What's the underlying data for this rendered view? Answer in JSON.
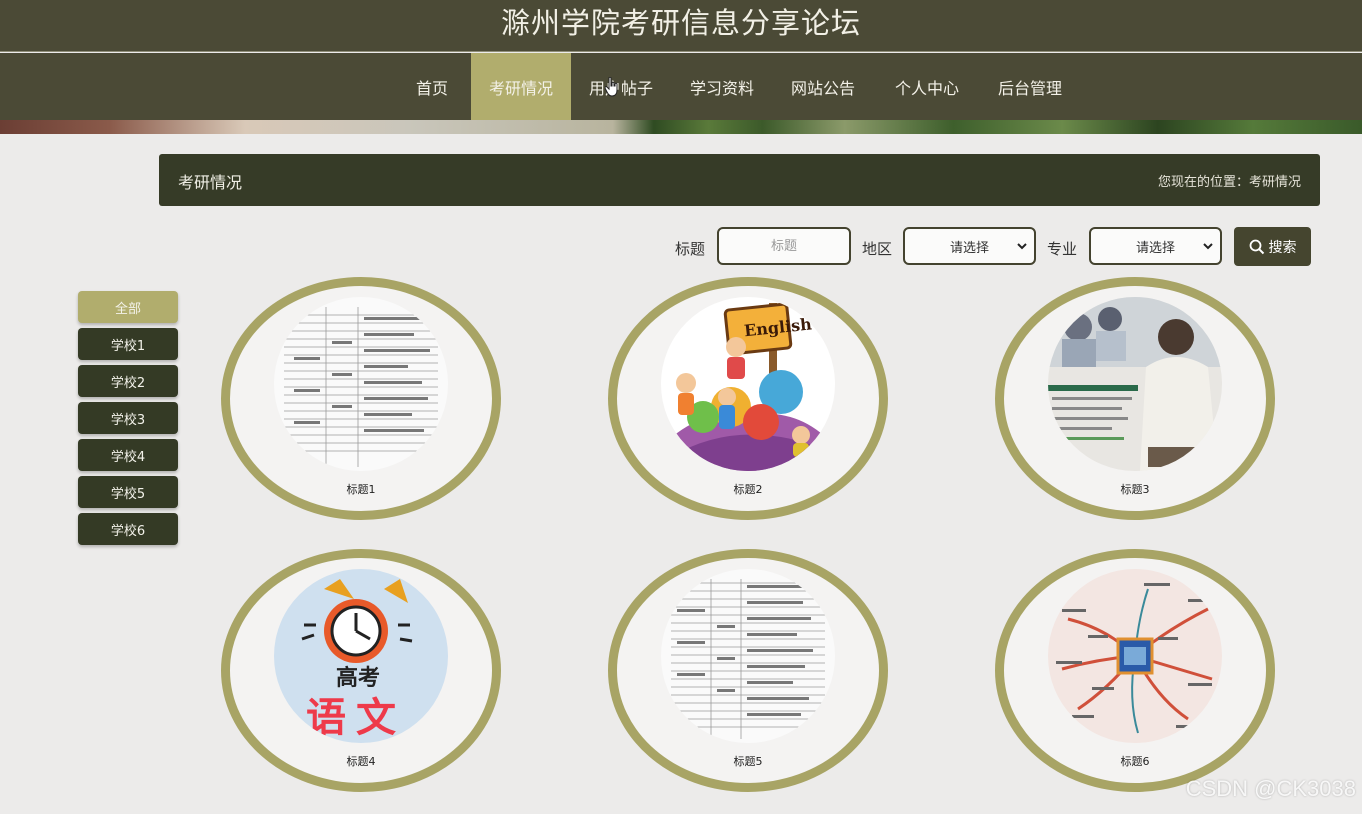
{
  "header": {
    "title": "滁州学院考研信息分享论坛"
  },
  "nav": {
    "items": [
      {
        "label": "首页"
      },
      {
        "label": "考研情况"
      },
      {
        "label": "用户帖子"
      },
      {
        "label": "学习资料"
      },
      {
        "label": "网站公告"
      },
      {
        "label": "个人中心"
      },
      {
        "label": "后台管理"
      }
    ],
    "active_index": 1
  },
  "section": {
    "title": "考研情况",
    "breadcrumb": "您现在的位置：考研情况"
  },
  "search": {
    "title_label": "标题",
    "title_placeholder": "标题",
    "region_label": "地区",
    "region_value": "请选择",
    "major_label": "专业",
    "major_value": "请选择",
    "button_label": "搜索"
  },
  "sidebar": {
    "items": [
      {
        "label": "全部"
      },
      {
        "label": "学校1"
      },
      {
        "label": "学校2"
      },
      {
        "label": "学校3"
      },
      {
        "label": "学校4"
      },
      {
        "label": "学校5"
      },
      {
        "label": "学校6"
      }
    ],
    "active_index": 0
  },
  "cards": [
    {
      "title": "标题1",
      "image": "document-table"
    },
    {
      "title": "标题2",
      "image": "english-kids-cartoon"
    },
    {
      "title": "标题3",
      "image": "chinese-textbook-poster"
    },
    {
      "title": "标题4",
      "image": "alarm-clock-gaokao-chinese"
    },
    {
      "title": "标题5",
      "image": "document-table"
    },
    {
      "title": "标题6",
      "image": "mind-map"
    }
  ],
  "thumb_text": {
    "english_sign": "English",
    "gaokao": "高考",
    "yuwen": "语文"
  },
  "watermark": "CSDN @CK3038",
  "colors": {
    "header_bg": "#4b4a36",
    "accent": "#b1ad6d",
    "dark_button": "#343a25",
    "ring": "#a8a465"
  }
}
